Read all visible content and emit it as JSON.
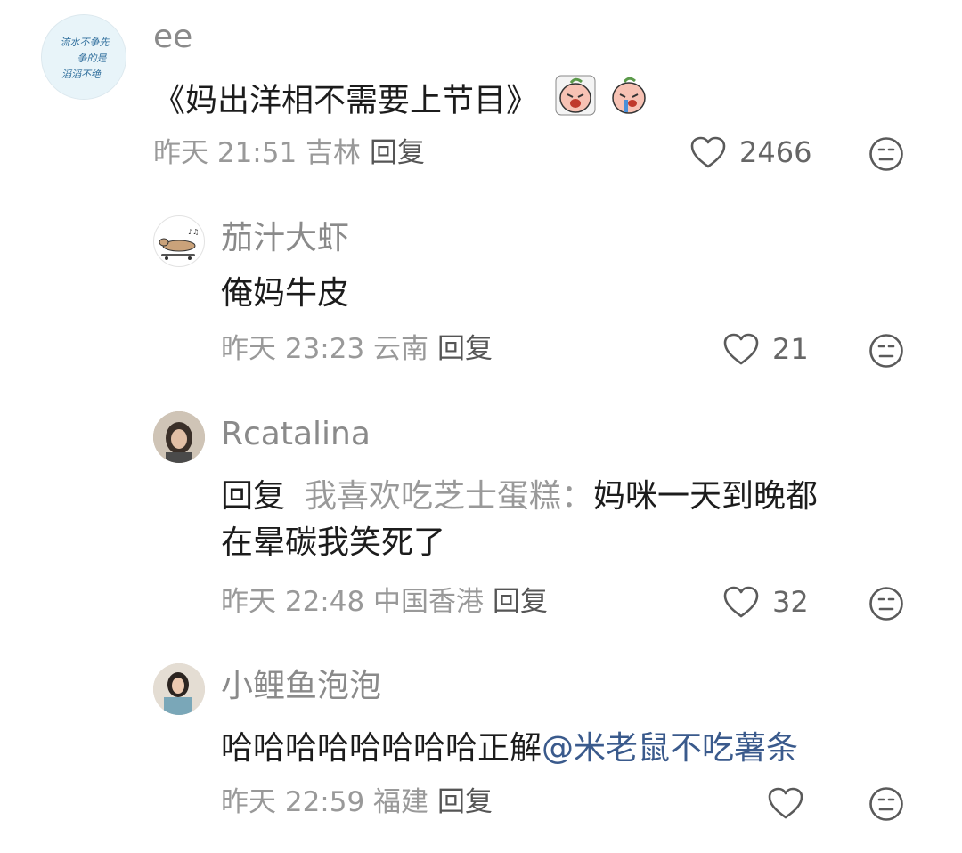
{
  "comments": [
    {
      "username": "ee",
      "avatar_text": [
        "流水不争先",
        "争的是",
        "滔滔不绝"
      ],
      "body": "《妈出洋相不需要上节目》",
      "emojis": [
        "crying-radish-emoji",
        "crying-radish-emoji"
      ],
      "meta": "昨天 21:51 吉林",
      "reply_label": "回复",
      "likes": "2466"
    },
    {
      "username": "茄汁大虾",
      "body": "俺妈牛皮",
      "meta": "昨天 23:23 云南",
      "reply_label": "回复",
      "likes": "21"
    },
    {
      "username": "Rcatalina",
      "reply_word": "回复",
      "reply_target": "我喜欢吃芝士蛋糕：",
      "body_line1": "妈咪一天到晚都",
      "body_line2": "在晕碳我笑死了",
      "meta": "昨天 22:48 中国香港",
      "reply_label": "回复",
      "likes": "32"
    },
    {
      "username": "小鲤鱼泡泡",
      "body": "哈哈哈哈哈哈哈哈正解",
      "mention": "@米老鼠不吃薯条",
      "meta": "昨天 22:59 福建",
      "reply_label": "回复",
      "likes": ""
    }
  ],
  "colors": {
    "username": "#8a8a8a",
    "meta": "#999999",
    "mention": "#3a5a8c",
    "icon": "#5a5a5a"
  }
}
